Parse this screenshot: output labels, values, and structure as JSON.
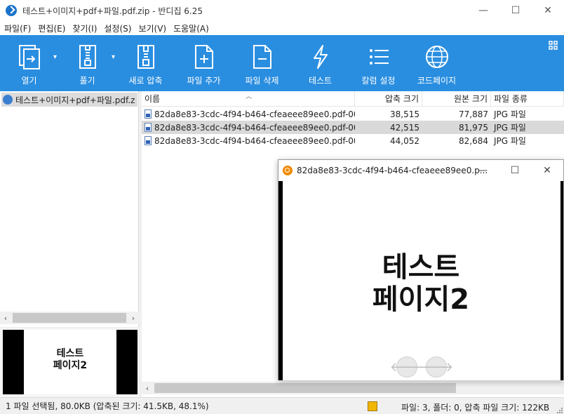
{
  "window": {
    "title": "테스트+이미지+pdf+파일.pdf.zip - 반디집 6.25",
    "minimize": "—",
    "maximize": "☐",
    "close": "✕"
  },
  "menu": [
    "파일(F)",
    "편집(E)",
    "찾기(I)",
    "설정(S)",
    "보기(V)",
    "도움말(A)"
  ],
  "toolbar": [
    {
      "label": "열기",
      "icon": "open-icon",
      "dropdown": true
    },
    {
      "label": "풀기",
      "icon": "extract-icon",
      "dropdown": true
    },
    {
      "label": "새로 압축",
      "icon": "new-archive-icon",
      "dropdown": false
    },
    {
      "label": "파일 추가",
      "icon": "add-file-icon",
      "dropdown": false
    },
    {
      "label": "파일 삭제",
      "icon": "delete-file-icon",
      "dropdown": false
    },
    {
      "label": "테스트",
      "icon": "test-icon",
      "dropdown": false
    },
    {
      "label": "칼럼 설정",
      "icon": "columns-icon",
      "dropdown": false
    },
    {
      "label": "코드페이지",
      "icon": "codepage-icon",
      "dropdown": false
    }
  ],
  "tree": {
    "item": "테스트+이미지+pdf+파일.pdf.z"
  },
  "preview_left": {
    "line1": "테스트",
    "line2": "페이지2"
  },
  "columns": {
    "name": "이름",
    "packed": "압축 크기",
    "original": "원본 크기",
    "type": "파일 종류"
  },
  "files": [
    {
      "name": "82da8e83-3cdc-4f94-b464-cfeaeee89ee0.pdf-00...",
      "packed": "38,515",
      "original": "77,887",
      "type": "JPG 파일",
      "selected": false
    },
    {
      "name": "82da8e83-3cdc-4f94-b464-cfeaeee89ee0.pdf-00...",
      "packed": "42,515",
      "original": "81,975",
      "type": "JPG 파일",
      "selected": true
    },
    {
      "name": "82da8e83-3cdc-4f94-b464-cfeaeee89ee0.pdf-00...",
      "packed": "44,052",
      "original": "82,684",
      "type": "JPG 파일",
      "selected": false
    }
  ],
  "viewer": {
    "title": "82da8e83-3cdc-4f94-b464-cfeaeee89ee0.p...",
    "line1": "테스트",
    "line2": "페이지2",
    "prev": "🡐",
    "next": "🡒"
  },
  "status": {
    "left": "1 파일 선택됨, 80.0KB (압축된 크기: 41.5KB, 48.1%)",
    "right": "파일: 3, 폴더: 0, 압축 파일 크기: 122KB"
  },
  "colors": {
    "toolbar": "#2a8ee0",
    "selection": "#d9d9d9"
  }
}
